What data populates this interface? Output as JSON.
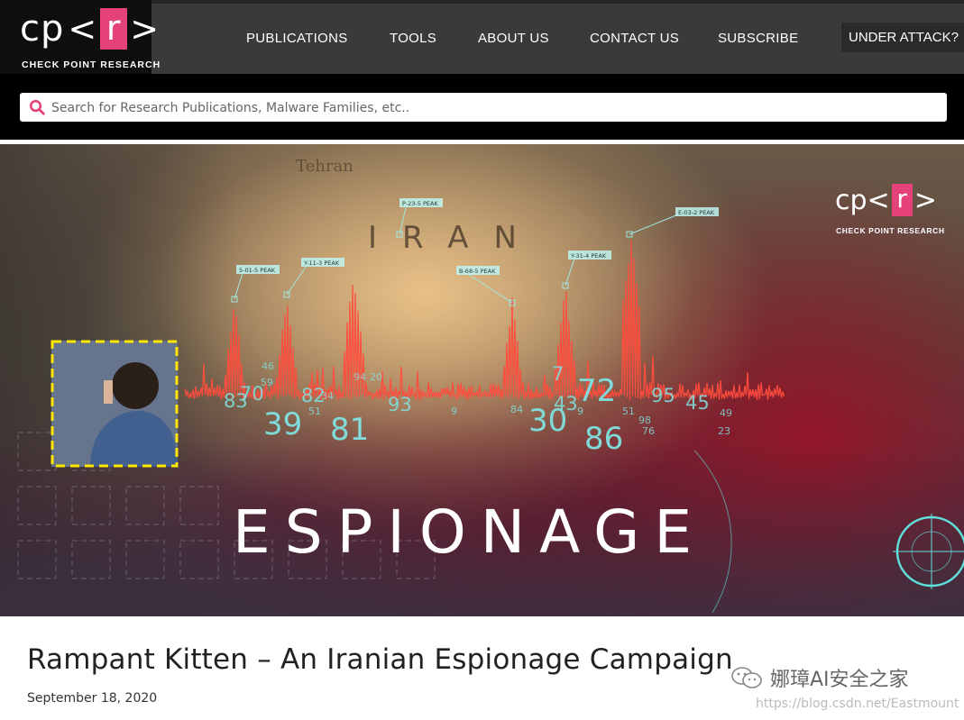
{
  "brand": {
    "logo_prefix": "cp",
    "logo_bracket_open": "<",
    "logo_letter": "r",
    "logo_bracket_close": ">",
    "subtitle": "CHECK POINT RESEARCH",
    "accent": "#e6427a"
  },
  "nav": {
    "items": [
      {
        "label": "PUBLICATIONS"
      },
      {
        "label": "TOOLS"
      },
      {
        "label": "ABOUT US"
      },
      {
        "label": "CONTACT US"
      },
      {
        "label": "SUBSCRIBE"
      }
    ],
    "attack_label": "UNDER ATTACK?"
  },
  "search": {
    "placeholder": "Search for Research Publications, Malware Families, etc..",
    "icon": "search-icon",
    "icon_color": "#e6427a"
  },
  "hero": {
    "word": "ESPIONAGE",
    "map_country": "IRAN",
    "map_city": "Tehran",
    "peak_labels": [
      "5-01-5 PEAK",
      "Y-11-3 PEAK",
      "P-23-5 PEAK",
      "B-68-5 PEAK",
      "Y-31-4 PEAK",
      "E-03-2 PEAK"
    ],
    "numbers_large": [
      "39",
      "81",
      "30",
      "86",
      "72"
    ],
    "numbers_medium": [
      "83",
      "70",
      "82",
      "93",
      "7",
      "43",
      "95",
      "45"
    ],
    "numbers_small": [
      "59",
      "46",
      "34",
      "51",
      "94",
      "20",
      "9",
      "84",
      "9",
      "51",
      "76",
      "98",
      "49",
      "23"
    ]
  },
  "article": {
    "title": "Rampant Kitten – An Iranian Espionage Campaign",
    "date": "September 18, 2020"
  },
  "watermark": {
    "text": "娜璋AI安全之家",
    "url": "https://blog.csdn.net/Eastmount"
  }
}
